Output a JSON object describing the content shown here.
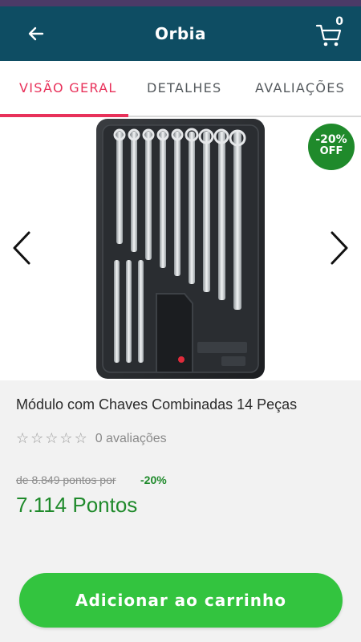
{
  "app": {
    "brand": "Orbia",
    "cart_count": "0"
  },
  "icons": {
    "back": "arrow-left-icon",
    "cart": "cart-icon",
    "prev": "chevron-left-icon",
    "next": "chevron-right-icon",
    "star": "star-outline-icon"
  },
  "colors": {
    "header": "#0e4d63",
    "accent_tab": "#e8315a",
    "price_green": "#1f8a2b",
    "cta_green": "#33c43f"
  },
  "tabs": [
    {
      "label": "VISÃO GERAL",
      "active": true
    },
    {
      "label": "DETALHES",
      "active": false
    },
    {
      "label": "AVALIAÇÕES",
      "active": false
    }
  ],
  "product": {
    "image_alt": "Módulo com Chaves Combinadas 14 Peças",
    "discount_badge": {
      "percent": "-20%",
      "suffix": "OFF"
    },
    "title": "Módulo com Chaves Combinadas 14 Peças",
    "rating": {
      "stars": 0,
      "max": 5,
      "reviews_text": "0 avaliações"
    },
    "old_price": "de 8.849 pontos por",
    "discount_percent": "-20%",
    "price": "7.114 Pontos"
  },
  "cta": {
    "label": "Adicionar ao carrinho"
  }
}
